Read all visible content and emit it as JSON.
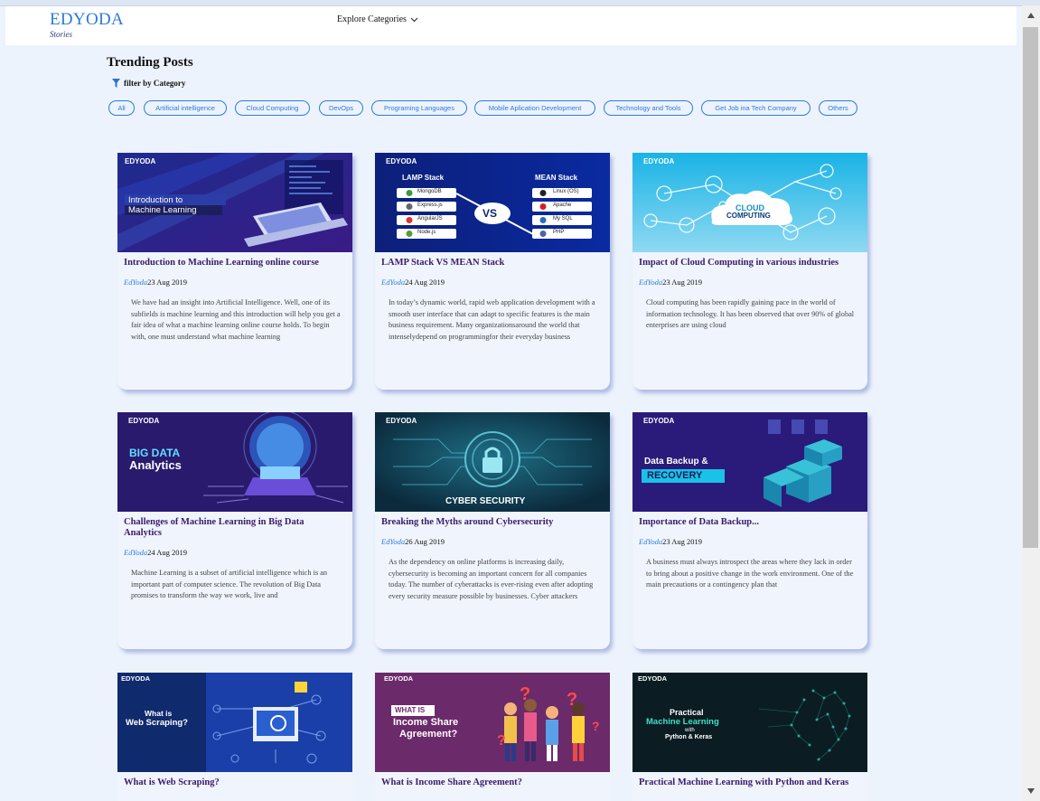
{
  "brand": {
    "name": "EDYODA",
    "sub": "Stories"
  },
  "nav": {
    "explore": "Explore Categories"
  },
  "page": {
    "heading": "Trending Posts",
    "filter_label": "filter by Category"
  },
  "colors": {
    "accent": "#2b7be0",
    "title": "#3b1a6a",
    "background": "#edf3fc"
  },
  "categories": [
    "All",
    "Artificial intelligence",
    "Cloud Computing",
    "DevOps",
    "Programing Languages",
    "Mobile Aplication Development",
    "Technology and Tools",
    "Get Job ina Tech Company",
    "Others"
  ],
  "posts": [
    {
      "image": {
        "logo": "EDYODA",
        "lines": [
          "Introduction to",
          "Machine Learning"
        ]
      },
      "title": "Introduction to Machine Learning online course",
      "author": "EdYoda",
      "date": "23 Aug 2019",
      "excerpt": "We have had an insight into Artificial Intelligence. Well, one of its subfields is machine learning and this introduction will help you get a fair idea of what a machine learning online course holds. To begin with, one must understand what machine learning"
    },
    {
      "image": {
        "logo": "EDYODA",
        "left_head": "LAMP Stack",
        "right_head": "MEAN Stack",
        "left_items": [
          "MongoDB",
          "Express.js",
          "AngularJS",
          "Node.js"
        ],
        "right_items": [
          "Linux (OS)",
          "Apache",
          "My SQL",
          "PHP"
        ],
        "vs": "VS"
      },
      "title": "LAMP Stack VS MEAN Stack",
      "author": "EdYoda",
      "date": "24 Aug 2019",
      "excerpt": "In today’s dynamic world, rapid web application development with a smooth user interface that can adapt to specific features is the main business requirement. Many organizationsaround the world that intenselydepend on programmingfor their everyday business"
    },
    {
      "image": {
        "logo": "EDYODA",
        "lines": [
          "CLOUD",
          "COMPUTING"
        ]
      },
      "title": "Impact of Cloud Computing in various industries",
      "author": "EdYoda",
      "date": "23 Aug 2019",
      "excerpt": "Cloud computing has been rapidly gaining pace in the world of information technology. It has been observed that over 90% of global enterprises are using cloud"
    },
    {
      "image": {
        "logo": "EDYODA",
        "lines": [
          "BIG DATA",
          "Analytics"
        ]
      },
      "title": "Challenges of Machine Learning in Big Data Analytics",
      "author": "EdYoda",
      "date": "24 Aug 2019",
      "excerpt": "Machine Learning is a subset of artificial intelligence which is an important part of computer science. The revolution of Big Data promises to transform the way we work, live and"
    },
    {
      "image": {
        "logo": "EDYODA",
        "lines": [
          "CYBER SECURITY"
        ]
      },
      "title": "Breaking the Myths around Cybersecurity",
      "author": "EdYoda",
      "date": "26 Aug 2019",
      "excerpt": "As the dependency on online platforms is increasing daily, cybersecurity is becoming an important concern for all companies today. The number of cyberattacks is ever-rising even after adopting every security measure possible by businesses. Cyber attackers"
    },
    {
      "image": {
        "logo": "EDYODA",
        "lines": [
          "Data Backup &",
          "RECOVERY"
        ]
      },
      "title": "Importance of Data Backup...",
      "author": "EdYoda",
      "date": "23 Aug 2019",
      "excerpt": "A business must always introspect the areas where they lack in order to bring about a positive change in the work environment. One of the main precautions or a contingency plan that"
    },
    {
      "image": {
        "logo": "EDYODA",
        "lines": [
          "What is",
          "Web Scraping?"
        ]
      },
      "title": "What is Web Scraping?",
      "author": "",
      "date": "",
      "excerpt": ""
    },
    {
      "image": {
        "logo": "EDYODA",
        "lines": [
          "WHAT IS",
          "Income Share",
          "Agreement?"
        ]
      },
      "title": "What is Income Share Agreement?",
      "author": "",
      "date": "",
      "excerpt": ""
    },
    {
      "image": {
        "logo": "EDYODA",
        "lines": [
          "Practical",
          "Machine Learning",
          "with",
          "Python & Keras"
        ]
      },
      "title": "Practical Machine Learning with Python and Keras",
      "author": "",
      "date": "",
      "excerpt": ""
    }
  ]
}
